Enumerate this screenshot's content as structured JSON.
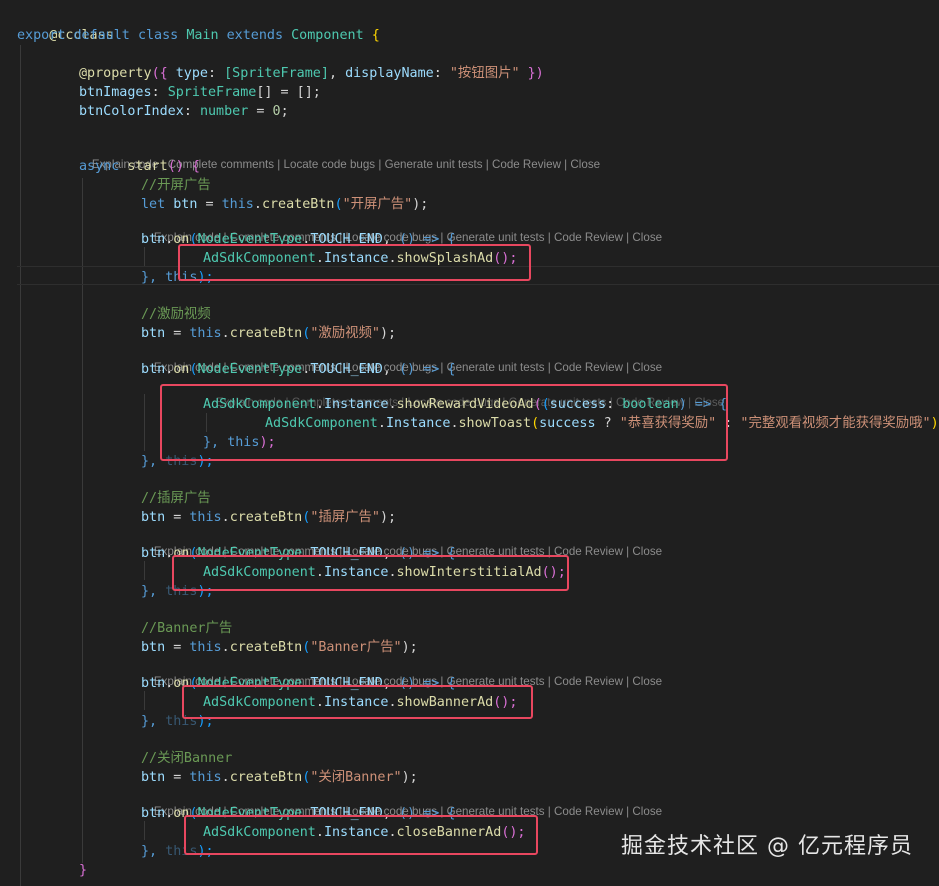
{
  "editor": {
    "theme": "dark",
    "codelens_labels": [
      "Explain code",
      "Complete comments",
      "Locate code bugs",
      "Generate unit tests",
      "Code Review",
      "Close"
    ],
    "codelens_separator": " | ",
    "highlight_color": "#e8475f"
  },
  "code": {
    "line1": "@ccclass",
    "line2": {
      "export": "export",
      "default": "default",
      "class": "class",
      "name": "Main",
      "extends": "extends",
      "base": "Component",
      "brace": "{"
    },
    "line3": {
      "dec": "@property",
      "open": "({ ",
      "type_key": "type",
      "colon": ": ",
      "type_val": "[SpriteFrame]",
      "comma": ", ",
      "dn_key": "displayName",
      "colon2": ": ",
      "dn_val": "\"按钮图片\"",
      "close": " })"
    },
    "line4": {
      "name": "btnImages",
      "colon": ": ",
      "type": "SpriteFrame",
      "rest": "[] = [];"
    },
    "line5": {
      "name": "btnColorIndex",
      "colon": ": ",
      "type": "number",
      "eq": " = ",
      "val": "0",
      "semi": ";"
    },
    "line6": {
      "async": "async",
      "fn": "start",
      "rest": "() {"
    },
    "comment_splash": "//开屏广告",
    "line_splash": {
      "let": "let",
      "btn": "btn",
      "eq": " = ",
      "this": "this",
      "dot": ".",
      "fn": "createBtn",
      "arg": "\"开屏广告\"",
      "end": ");"
    },
    "on_splash": {
      "btn": "btn",
      "on": "on",
      "evt": "NodeEventType",
      "touch": "TOUCH_END",
      "arrow": "() => {"
    },
    "call_splash": {
      "cls": "AdSdkComponent",
      "inst": "Instance",
      "fn": "showSplashAd",
      "end": "();"
    },
    "close_splash": {
      "brace": "}, ",
      "this": "this",
      "end": ");"
    },
    "comment_reward": "//激励视频",
    "line_reward": {
      "btn": "btn",
      "eq": " = ",
      "this": "this",
      "fn": "createBtn",
      "arg": "\"激励视频\"",
      "end": ");"
    },
    "on_reward": {
      "btn": "btn",
      "on": "on",
      "evt": "NodeEventType",
      "touch": "TOUCH_END",
      "arrow": "() => {"
    },
    "call_reward": {
      "cls": "AdSdkComponent",
      "inst": "Instance",
      "fn": "showRewardVideoAd",
      "param": "success",
      "ptype": "boolean",
      "arrow": ") => {"
    },
    "toast": {
      "cls": "AdSdkComponent",
      "inst": "Instance",
      "fn": "showToast",
      "param": "success",
      "q": " ? ",
      "s1": "\"恭喜获得奖励\"",
      "c": " : ",
      "s2": "\"完整观看视频才能获得奖励哦\"",
      "end": ");"
    },
    "close_reward_inner": {
      "brace": "}, ",
      "this": "this",
      "end": ");"
    },
    "close_reward": {
      "brace": "}, ",
      "this": "this",
      "end": ");"
    },
    "comment_inter": "//插屏广告",
    "line_inter": {
      "btn": "btn",
      "eq": " = ",
      "this": "this",
      "fn": "createBtn",
      "arg": "\"插屏广告\"",
      "end": ");"
    },
    "on_inter": {
      "btn": "btn",
      "on": "on",
      "evt": "NodeEventType",
      "touch": "TOUCH_END",
      "arrow": "() => {"
    },
    "call_inter": {
      "cls": "AdSdkComponent",
      "inst": "Instance",
      "fn": "showInterstitialAd",
      "end": "();"
    },
    "close_inter": {
      "brace": "}, ",
      "this": "this",
      "end": ");"
    },
    "comment_banner": "//Banner广告",
    "line_banner": {
      "btn": "btn",
      "eq": " = ",
      "this": "this",
      "fn": "createBtn",
      "arg": "\"Banner广告\"",
      "end": ");"
    },
    "on_banner": {
      "btn": "btn",
      "on": "on",
      "evt": "NodeEventType",
      "touch": "TOUCH_END",
      "arrow": "() => {"
    },
    "call_banner": {
      "cls": "AdSdkComponent",
      "inst": "Instance",
      "fn": "showBannerAd",
      "end": "();"
    },
    "close_banner": {
      "brace": "}, ",
      "this": "this",
      "end": ");"
    },
    "comment_close": "//关闭Banner",
    "line_close": {
      "btn": "btn",
      "eq": " = ",
      "this": "this",
      "fn": "createBtn",
      "arg": "\"关闭Banner\"",
      "end": ");"
    },
    "on_close": {
      "btn": "btn",
      "on": "on",
      "evt": "NodeEventType",
      "touch": "TOUCH_END",
      "arrow": "() => {"
    },
    "call_close": {
      "cls": "AdSdkComponent",
      "inst": "Instance",
      "fn": "closeBannerAd",
      "end": "();"
    },
    "close_close": {
      "brace": "}, ",
      "this": "this",
      "end": ");"
    },
    "final_brace": "}"
  },
  "watermark": "掘金技术社区 @ 亿元程序员"
}
